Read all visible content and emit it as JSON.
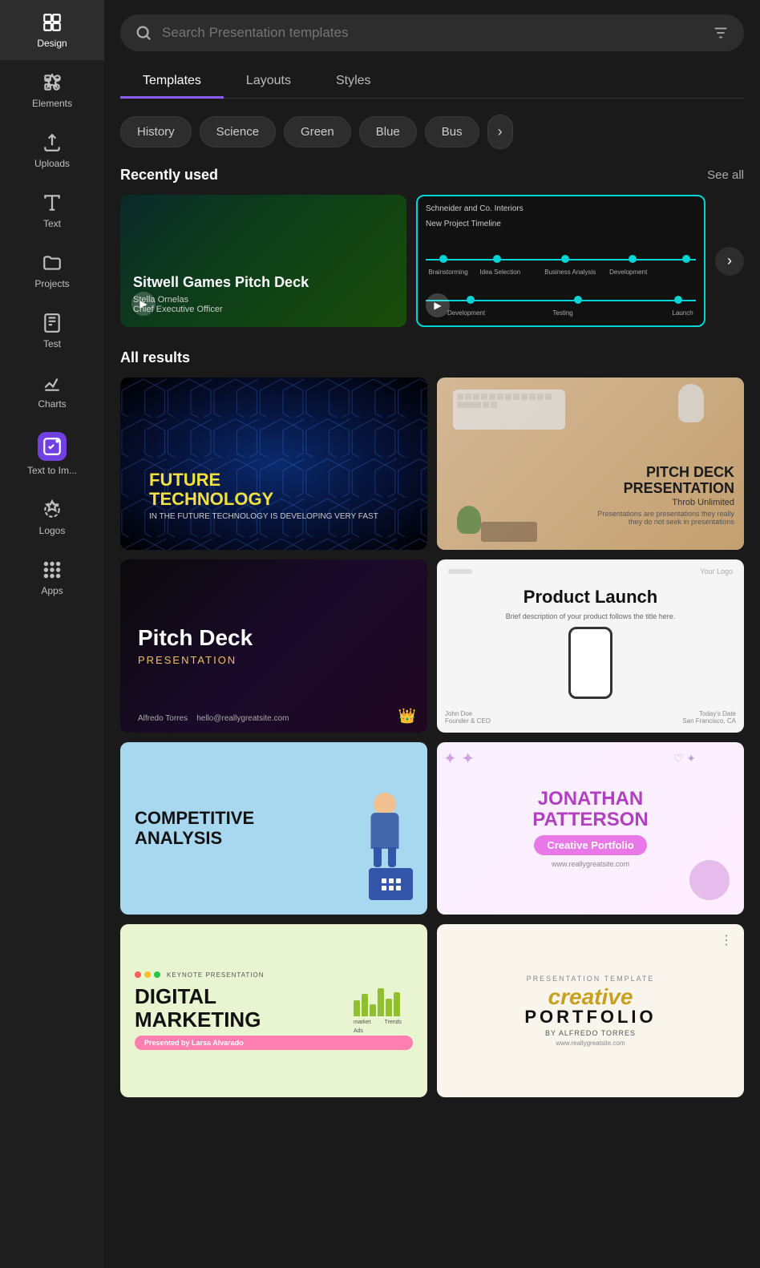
{
  "sidebar": {
    "items": [
      {
        "id": "design",
        "label": "Design",
        "active": true
      },
      {
        "id": "elements",
        "label": "Elements"
      },
      {
        "id": "uploads",
        "label": "Uploads"
      },
      {
        "id": "text",
        "label": "Text"
      },
      {
        "id": "projects",
        "label": "Projects"
      },
      {
        "id": "test",
        "label": "Test"
      },
      {
        "id": "charts",
        "label": "Charts"
      },
      {
        "id": "text-to-image",
        "label": "Text to Im..."
      },
      {
        "id": "logos",
        "label": "Logos"
      },
      {
        "id": "apps",
        "label": "Apps"
      }
    ]
  },
  "search": {
    "placeholder": "Search Presentation templates"
  },
  "tabs": [
    {
      "id": "templates",
      "label": "Templates",
      "active": true
    },
    {
      "id": "layouts",
      "label": "Layouts",
      "active": false
    },
    {
      "id": "styles",
      "label": "Styles",
      "active": false
    }
  ],
  "chips": [
    {
      "id": "history",
      "label": "History"
    },
    {
      "id": "science",
      "label": "Science"
    },
    {
      "id": "green",
      "label": "Green"
    },
    {
      "id": "blue",
      "label": "Blue"
    },
    {
      "id": "business",
      "label": "Bus"
    }
  ],
  "recently_used": {
    "section_title": "Recently used",
    "see_all": "See all",
    "items": [
      {
        "id": "sitwell-games",
        "title": "Sitwell Games Pitch Deck",
        "subtitle": "Stella Ornelas",
        "role": "Chief Executive Officer"
      },
      {
        "id": "project-timeline",
        "title": "Schneider and Co. Interiors",
        "subtitle": "New Project Timeline"
      }
    ]
  },
  "all_results": {
    "section_title": "All results",
    "items": [
      {
        "id": "future-technology",
        "title": "FUTURE",
        "title2": "TECHNOLOGY",
        "subtitle": "IN THE FUTURE TECHNOLOGY IS DEVELOPING VERY FAST",
        "theme": "dark-blue"
      },
      {
        "id": "pitch-deck-presentation",
        "title": "PITCH DECK",
        "title2": "PRESENTATION",
        "brand": "Throb Unlimited",
        "theme": "photo-tan"
      },
      {
        "id": "pitch-deck-dark",
        "title": "Pitch Deck",
        "subtitle": "PRESENTATION",
        "author": "Alfredo Torres",
        "email": "hello@reallygreatsite.com",
        "theme": "dark-purple"
      },
      {
        "id": "product-launch",
        "title": "Product Launch",
        "desc": "Brief description of your product follows the title here.",
        "name": "John Doe",
        "role2": "Founder & CEO",
        "date": "Today's Date",
        "location": "San Francisco, CA",
        "theme": "light"
      },
      {
        "id": "competitive-analysis",
        "title": "COMPETITIVE",
        "title2": "ANALYSIS",
        "theme": "blue-light"
      },
      {
        "id": "jonathan-patterson",
        "title": "JONATHAN",
        "title2": "PATTERSON",
        "subtitle": "Creative Portfolio",
        "url": "www.reallygreatsite.com",
        "theme": "pastel-purple"
      },
      {
        "id": "digital-marketing",
        "title": "DIGITAL",
        "title2": "MARKETING",
        "presenter": "Presented by Larsa Alvarado",
        "header": "KEYNOTE PRESENTATION",
        "theme": "green-light"
      },
      {
        "id": "creative-portfolio",
        "title": "creative",
        "title2": "PORTFOLIO",
        "subtitle": "BY ALFREDO TORRES",
        "small": "PRESENTATION TEMPLATE",
        "url": "www.reallygreatsite.com",
        "theme": "cream"
      }
    ]
  }
}
